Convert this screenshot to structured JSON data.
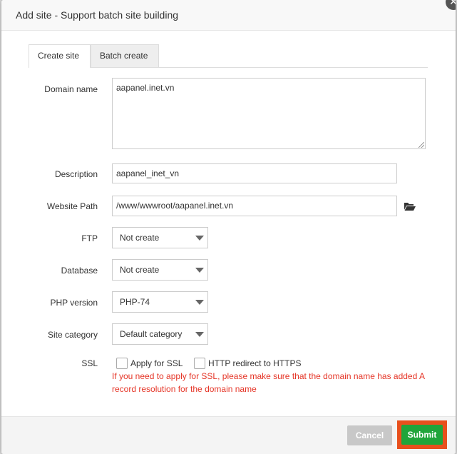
{
  "dialog": {
    "title": "Add site - Support batch site building",
    "close_symbol": "✕"
  },
  "tabs": [
    {
      "label": "Create site",
      "active": true
    },
    {
      "label": "Batch create",
      "active": false
    }
  ],
  "form": {
    "domain": {
      "label": "Domain name",
      "value": "aapanel.inet.vn"
    },
    "description": {
      "label": "Description",
      "value": "aapanel_inet_vn"
    },
    "path": {
      "label": "Website Path",
      "value": "/www/wwwroot/aapanel.inet.vn",
      "icon": "folder-open-icon"
    },
    "ftp": {
      "label": "FTP",
      "value": "Not create"
    },
    "database": {
      "label": "Database",
      "value": "Not create"
    },
    "php": {
      "label": "PHP version",
      "value": "PHP-74"
    },
    "category": {
      "label": "Site category",
      "value": "Default category"
    },
    "ssl": {
      "label": "SSL",
      "apply_label": "Apply for SSL",
      "apply_checked": false,
      "redirect_label": "HTTP redirect to HTTPS",
      "redirect_checked": false,
      "warning": "If you need to apply for SSL, please make sure that the domain name has added A record resolution for the domain name"
    }
  },
  "footer": {
    "cancel_label": "Cancel",
    "submit_label": "Submit"
  },
  "colors": {
    "submit": "#20a53a",
    "highlight": "#e8501d",
    "warning": "#e53527",
    "cancel": "#c8c8c8"
  }
}
